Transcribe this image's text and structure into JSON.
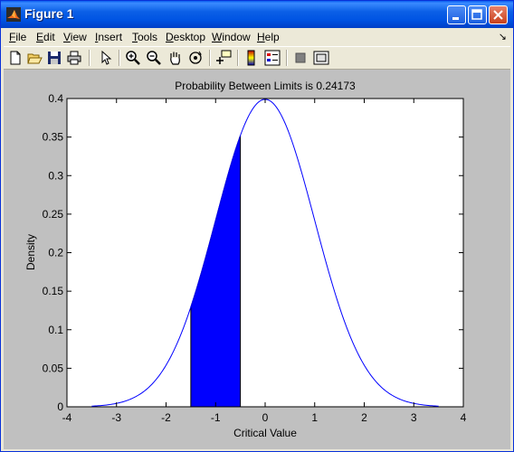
{
  "window": {
    "title": "Figure 1",
    "app_icon": "matlab-icon"
  },
  "title_buttons": [
    "minimize-icon",
    "maximize-icon",
    "close-icon"
  ],
  "menu": [
    {
      "label": "File",
      "key": "F"
    },
    {
      "label": "Edit",
      "key": "E"
    },
    {
      "label": "View",
      "key": "V"
    },
    {
      "label": "Insert",
      "key": "I"
    },
    {
      "label": "Tools",
      "key": "T"
    },
    {
      "label": "Desktop",
      "key": "D"
    },
    {
      "label": "Window",
      "key": "W"
    },
    {
      "label": "Help",
      "key": "H"
    }
  ],
  "toolbar": [
    "new-figure-icon",
    "open-file-icon",
    "save-icon",
    "print-icon",
    "edit-plot-arrow-icon",
    "zoom-in-icon",
    "zoom-out-icon",
    "pan-hand-icon",
    "rotate-3d-icon",
    "data-cursor-icon",
    "insert-colorbar-icon",
    "insert-legend-icon",
    "hide-plot-tools-icon",
    "show-plot-tools-icon"
  ],
  "chart_data": {
    "type": "area",
    "title": "Probability Between Limits is 0.24173",
    "xlabel": "Critical Value",
    "ylabel": "Density",
    "xlim": [
      -4,
      4
    ],
    "ylim": [
      0,
      0.4
    ],
    "xticks": [
      "-4",
      "-3",
      "-2",
      "-1",
      "0",
      "1",
      "2",
      "3",
      "4"
    ],
    "yticks": [
      "0",
      "0.05",
      "0.1",
      "0.15",
      "0.2",
      "0.25",
      "0.3",
      "0.35",
      "0.4"
    ],
    "curve": {
      "distribution": "standard normal pdf",
      "mean": 0,
      "sd": 1,
      "x_range": [
        -3.5,
        3.5
      ],
      "color": "#0000ff"
    },
    "shaded_region": {
      "x_from": -1.5,
      "x_to": -0.5,
      "color": "#0000ff",
      "probability": 0.24173
    },
    "grid": false,
    "background": "#ffffff"
  }
}
